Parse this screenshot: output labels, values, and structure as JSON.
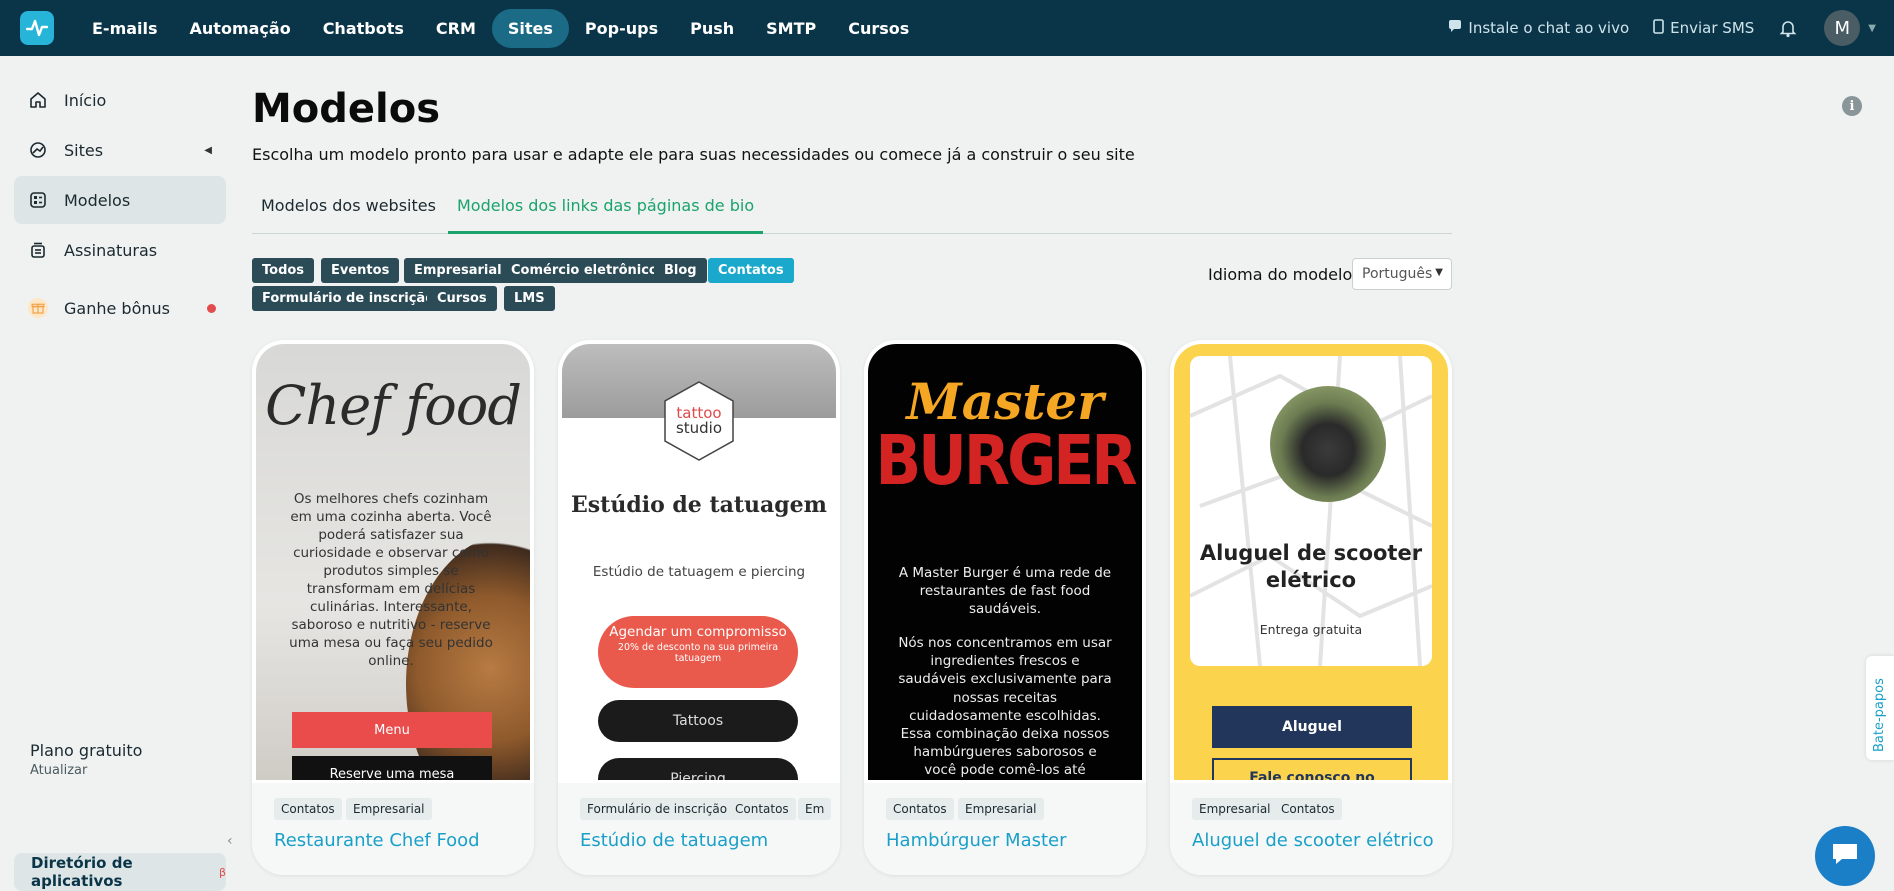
{
  "topnav": {
    "items": [
      "E-mails",
      "Automação",
      "Chatbots",
      "CRM",
      "Sites",
      "Pop-ups",
      "Push",
      "SMTP",
      "Cursos"
    ],
    "active": "Sites",
    "install_chat": "Instale o chat ao vivo",
    "send_sms": "Enviar SMS",
    "avatar_letter": "M"
  },
  "sidebar": {
    "items": [
      {
        "label": "Início",
        "icon": "home-icon"
      },
      {
        "label": "Sites",
        "icon": "sites-icon"
      },
      {
        "label": "Modelos",
        "icon": "templates-icon"
      },
      {
        "label": "Assinaturas",
        "icon": "subscriptions-icon"
      },
      {
        "label": "Ganhe bônus",
        "icon": "gift-icon"
      }
    ],
    "plan": "Plano gratuito",
    "upgrade": "Atualizar",
    "app_directory": "Diretório de aplicativos",
    "beta": "β"
  },
  "page": {
    "title": "Modelos",
    "subtitle": "Escolha um modelo pronto para usar e adapte ele para suas necessidades ou comece já a construir o seu site",
    "tabs": [
      "Modelos dos websites",
      "Modelos dos links das páginas de bio"
    ],
    "active_tab": "Modelos dos links das páginas de bio"
  },
  "filters": {
    "chips": [
      "Todos",
      "Eventos",
      "Empresarial",
      "Comércio eletrônico",
      "Blog",
      "Contatos",
      "Formulário de inscrição",
      "Cursos",
      "LMS"
    ],
    "active": "Contatos",
    "language_label": "Idioma do modelo:",
    "language_value": "Português"
  },
  "cards": [
    {
      "title": "Restaurante Chef Food",
      "tags": [
        "Contatos",
        "Empresarial"
      ],
      "preview": {
        "heading": "Chef food",
        "text": "Os melhores chefs cozinham em uma cozinha aberta. Você poderá satisfazer sua curiosidade e observar como produtos simples se transformam em delícias culinárias. Interessante, saboroso e nutritivo - reserve uma mesa ou faça seu pedido online.",
        "button1": "Menu",
        "button2": "Reserve uma mesa"
      }
    },
    {
      "title": "Estúdio de tatuagem",
      "tags": [
        "Formulário de inscrição",
        "Contatos",
        "Em"
      ],
      "preview": {
        "logo_line1": "tattoo",
        "logo_line2": "studio",
        "heading": "Estúdio de tatuagem",
        "subtitle": "Estúdio de tatuagem e piercing",
        "cta": "Agendar um compromisso",
        "cta_small": "20% de desconto na sua primeira tatuagem",
        "button1": "Tattoos",
        "button2": "Piercing"
      }
    },
    {
      "title": "Hambúrguer Master",
      "tags": [
        "Contatos",
        "Empresarial"
      ],
      "preview": {
        "logo_top": "Master",
        "logo_bottom": "BURGER",
        "text1": "A Master Burger é uma rede de restaurantes de fast food saudáveis.",
        "text2": "Nós nos concentramos em usar ingredientes frescos e saudáveis exclusivamente para nossas receitas cuidadosamente escolhidas. Essa combinação deixa nossos hambúrgueres saborosos e você pode comê-los até"
      }
    },
    {
      "title": "Aluguel de scooter elétrico",
      "tags": [
        "Empresarial",
        "Contatos"
      ],
      "preview": {
        "heading": "Aluguel de scooter elétrico",
        "subtitle": "Entrega gratuita",
        "button1": "Aluguel",
        "button2": "Fale conosco no"
      }
    }
  ],
  "chat_tab": "Bate-papos",
  "colors": {
    "topbar": "#0a3548",
    "accent_green": "#1aa36a",
    "chip_active": "#1aa8cc",
    "link": "#1aa0c8"
  }
}
